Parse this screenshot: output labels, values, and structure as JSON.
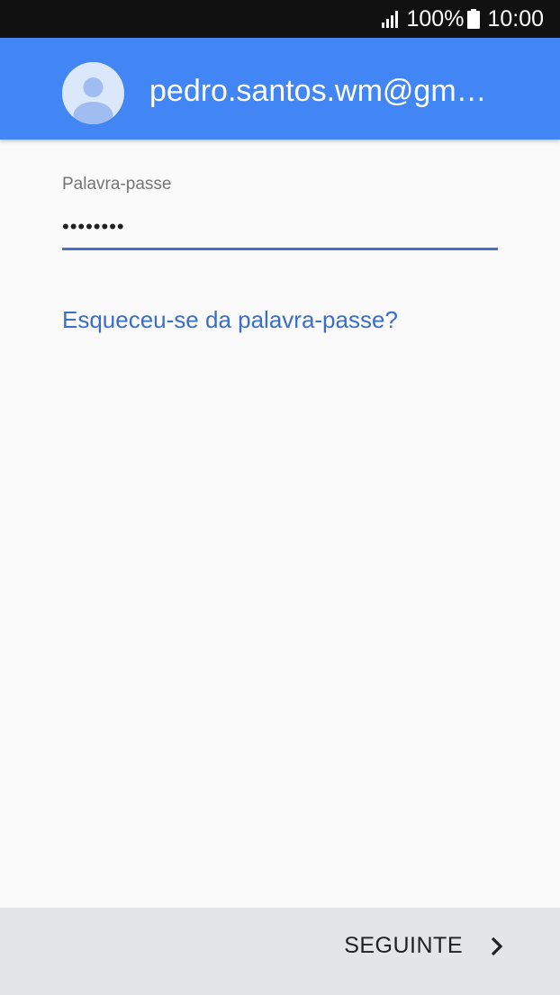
{
  "status_bar": {
    "battery_text": "100%",
    "time": "10:00",
    "signal_icon": "signal-icon",
    "battery_icon": "battery-icon"
  },
  "header": {
    "account_email": "pedro.santos.wm@gm…",
    "avatar_icon": "account-avatar-icon",
    "background_color": "#4285f4"
  },
  "password_field": {
    "label": "Palavra-passe",
    "value": "••••••••",
    "accent_color": "#4a6fc4"
  },
  "forgot_password_link": "Esqueceu-se da palavra-passe?",
  "footer": {
    "next_label": "SEGUINTE",
    "next_icon": "chevron-right-icon"
  }
}
